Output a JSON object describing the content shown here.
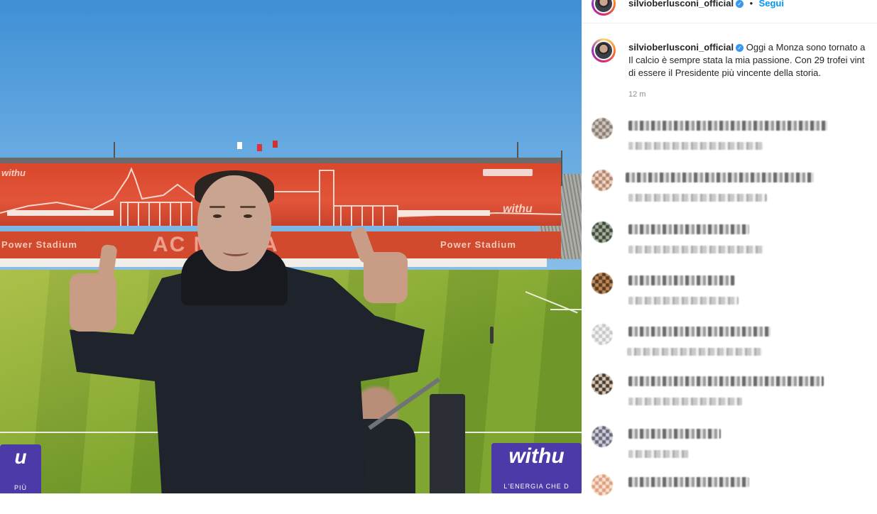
{
  "post": {
    "username": "silvioberlusconi_official",
    "verified_icon": "verified-badge-icon",
    "follow_label": "Segui",
    "separator": "•",
    "caption_line1": "Oggi a Monza sono tornato a",
    "caption_line2": "Il calcio è sempre stata la mia passione. Con 29 trofei vint",
    "caption_line3": "di essere il Presidente più vincente della storia.",
    "time_ago": "12 m"
  },
  "photo": {
    "stadium_banner_left": "Power Stadium",
    "stadium_banner_center": "AC MONZA",
    "stadium_banner_right": "Power Stadium",
    "stand_brand": "withu",
    "stand_brand_small": "withu",
    "board_left_text": "u",
    "board_left_sub": "PIÙ",
    "board_right_text": "withu",
    "board_right_sub": "L'ENERGIA CHE D"
  },
  "comments_note": "pixelated",
  "colors": {
    "follow_blue": "#0095f6",
    "verified_blue": "#3897f0",
    "stand_red": "#d9472c",
    "grass_green": "#7fa630",
    "board_purple": "#4b3aa8"
  }
}
